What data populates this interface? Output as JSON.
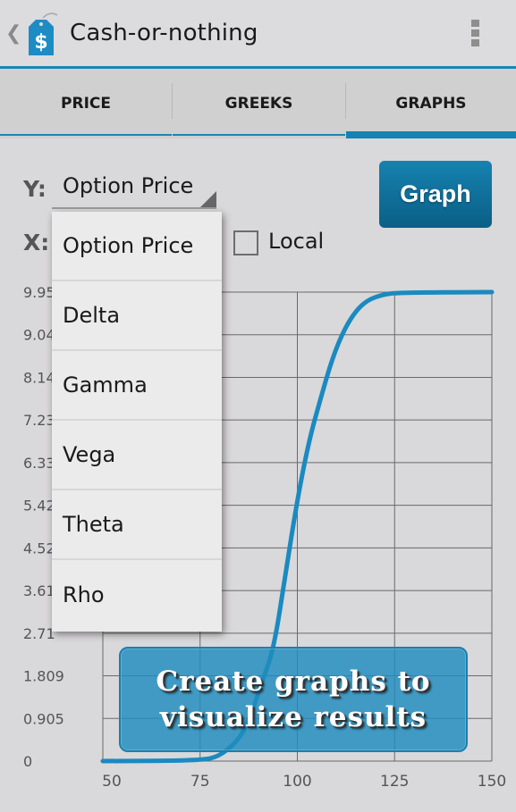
{
  "actionbar": {
    "title": "Cash-or-nothing",
    "back_icon": "chevron-left-icon",
    "app_icon": "dollar-price-tag-icon",
    "overflow_icon": "overflow-menu-icon",
    "accent_color": "#1b86b3"
  },
  "tabs": [
    {
      "label": "PRICE",
      "active": false
    },
    {
      "label": "GREEKS",
      "active": false
    },
    {
      "label": "GRAPHS",
      "active": true
    }
  ],
  "controls": {
    "y_label": "Y:",
    "x_label": "X:",
    "y_selected": "Option Price",
    "graph_button": "Graph",
    "local_label": "Local",
    "local_checked": false
  },
  "dropdown": {
    "options": [
      "Option Price",
      "Delta",
      "Gamma",
      "Vega",
      "Theta",
      "Rho"
    ]
  },
  "banner": {
    "line1": "Create graphs to",
    "line2": "visualize results"
  },
  "chart_data": {
    "type": "line",
    "title": "",
    "xlabel": "",
    "ylabel": "Option Price",
    "xlim": [
      50,
      150
    ],
    "ylim": [
      0,
      9.95
    ],
    "grid": true,
    "x_ticks": [
      "50",
      "75",
      "100",
      "125",
      "150"
    ],
    "y_ticks": [
      "0",
      "0.905",
      "1.809",
      "2.71",
      "3.61",
      "4.52",
      "5.42",
      "6.33",
      "7.23",
      "8.14",
      "9.04",
      "9.95"
    ],
    "series": [
      {
        "name": "Option Price",
        "color": "#1a8ac0",
        "x": [
          50,
          75,
          80,
          85,
          88,
          91,
          94,
          97,
          100,
          103,
          106,
          109,
          112,
          115,
          118,
          122,
          126,
          150
        ],
        "y": [
          0,
          0.01,
          0.1,
          0.45,
          0.95,
          1.7,
          2.4,
          4.0,
          5.55,
          6.8,
          7.7,
          8.55,
          9.15,
          9.55,
          9.78,
          9.9,
          9.94,
          9.95
        ]
      }
    ]
  }
}
